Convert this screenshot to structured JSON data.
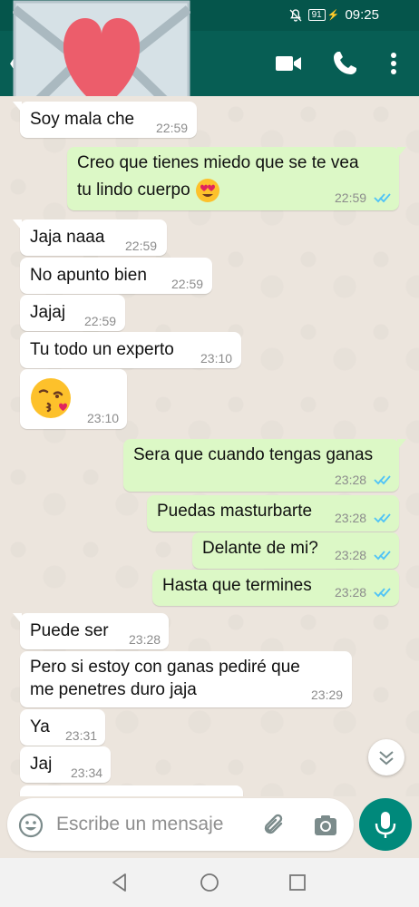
{
  "status_bar": {
    "battery": "91",
    "time": "09:25"
  },
  "header": {
    "avatar_icon": "envelope-heart-icon",
    "actions": [
      "video-call-icon",
      "phone-icon",
      "more-vert-icon"
    ]
  },
  "messages": [
    {
      "direction": "in",
      "text": "Soy mala che",
      "time": "22:59"
    },
    {
      "direction": "out",
      "text": "Creo que tienes miedo que se te vea",
      "text2": "tu lindo cuerpo",
      "emoji": "heart-eyes-emoji",
      "time": "22:59",
      "read": true
    },
    {
      "direction": "in",
      "text": "Jaja naaa",
      "time": "22:59"
    },
    {
      "direction": "in",
      "text": "No apunto bien",
      "time": "22:59"
    },
    {
      "direction": "in",
      "text": "Jajaj",
      "time": "22:59"
    },
    {
      "direction": "in",
      "text": "Tu todo un experto",
      "time": "23:10"
    },
    {
      "direction": "in",
      "emoji": "kissing-heart-emoji",
      "time": "23:10"
    },
    {
      "direction": "out",
      "text": "Sera que cuando tengas ganas",
      "time": "23:28",
      "read": true
    },
    {
      "direction": "out",
      "text": "Puedas masturbarte",
      "time": "23:28",
      "read": true
    },
    {
      "direction": "out",
      "text": "Delante de mi?",
      "time": "23:28",
      "read": true
    },
    {
      "direction": "out",
      "text": "Hasta que termines",
      "time": "23:28",
      "read": true
    },
    {
      "direction": "in",
      "text": "Puede ser",
      "time": "23:28"
    },
    {
      "direction": "in",
      "text": "Pero si estoy con ganas pediré que",
      "text2": "me penetres duro jaja",
      "time": "23:29"
    },
    {
      "direction": "in",
      "text": "Ya",
      "time": "23:31"
    },
    {
      "direction": "in",
      "text": "Jaj",
      "time": "23:34"
    }
  ],
  "composer": {
    "placeholder": "Escribe un mensaje",
    "icons": [
      "emoji-icon",
      "attach-icon",
      "camera-icon",
      "mic-icon"
    ]
  },
  "colors": {
    "header": "#075e54",
    "status_bar": "#05554b",
    "incoming_bubble": "#ffffff",
    "outgoing_bubble": "#dcf8c6",
    "read_ticks": "#4fc3f7",
    "mic_button": "#00897b"
  }
}
